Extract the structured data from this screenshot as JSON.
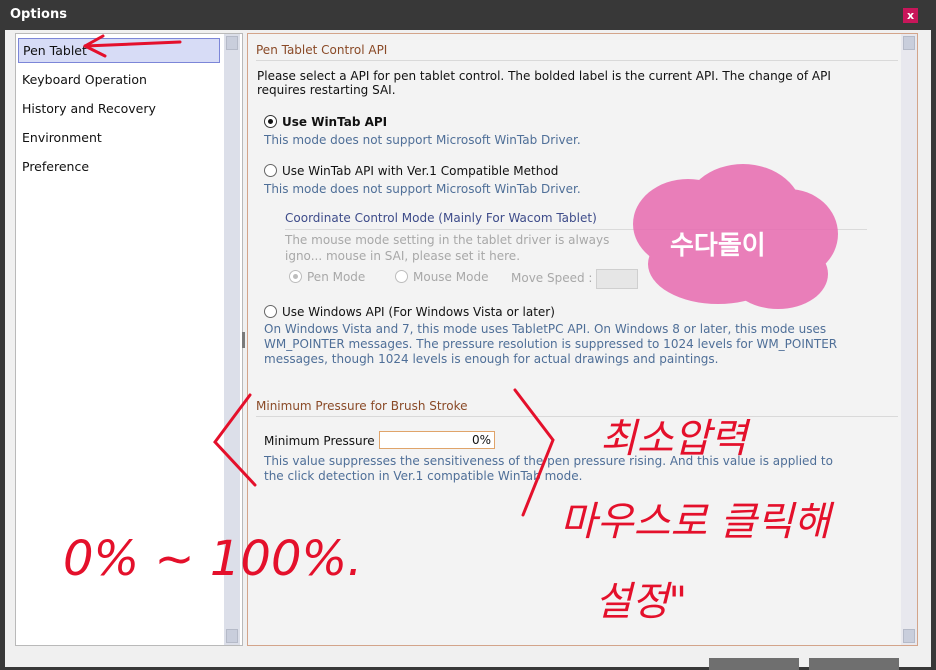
{
  "window": {
    "title": "Options",
    "close_glyph": "x"
  },
  "sidebar": {
    "items": [
      {
        "label": "Pen Tablet",
        "selected": true
      },
      {
        "label": "Keyboard Operation"
      },
      {
        "label": "History and Recovery"
      },
      {
        "label": "Environment"
      },
      {
        "label": "Preference"
      }
    ]
  },
  "pen_api": {
    "header": "Pen Tablet Control API",
    "description": "Please select a API for pen tablet control. The bolded label is the current API. The change of API requires restarting SAI.",
    "options": [
      {
        "label": "Use WinTab API",
        "note": "This mode does not support Microsoft WinTab Driver.",
        "checked": true
      },
      {
        "label": "Use WinTab API with Ver.1 Compatible Method",
        "note": "This mode does not support Microsoft WinTab Driver.",
        "checked": false
      },
      {
        "label": "Use Windows API (For Windows Vista or later)",
        "note": "On Windows Vista and 7, this mode uses TabletPC API. On Windows 8 or later, this mode uses WM_POINTER messages. The pressure resolution is suppressed to 1024 levels for WM_POINTER messages, though 1024 levels is enough for actual drawings and paintings.",
        "checked": false
      }
    ],
    "coordinate_group": {
      "header": "Coordinate Control Mode (Mainly For Wacom Tablet)",
      "text": "The mouse mode setting in the tablet driver is always igno... mouse in SAI, please set it here.",
      "pen_mode": "Pen Mode",
      "mouse_mode": "Mouse Mode",
      "move_speed": "Move Speed :"
    }
  },
  "pressure": {
    "header": "Minimum Pressure for Brush Stroke",
    "label": "Minimum Pressure :",
    "value": "0%",
    "note": "This value suppresses the sensitiveness of the pen pressure rising. And this value is applied to the click detection in Ver.1 compatible WinTab mode."
  },
  "annotations": {
    "range": "0% ~ 100%.",
    "korean_line1": "최소압력",
    "korean_line2": "마우스로 클릭해",
    "korean_line3": "설정\"",
    "sticker": "수다돌이",
    "ink_color": "#e4102b"
  }
}
